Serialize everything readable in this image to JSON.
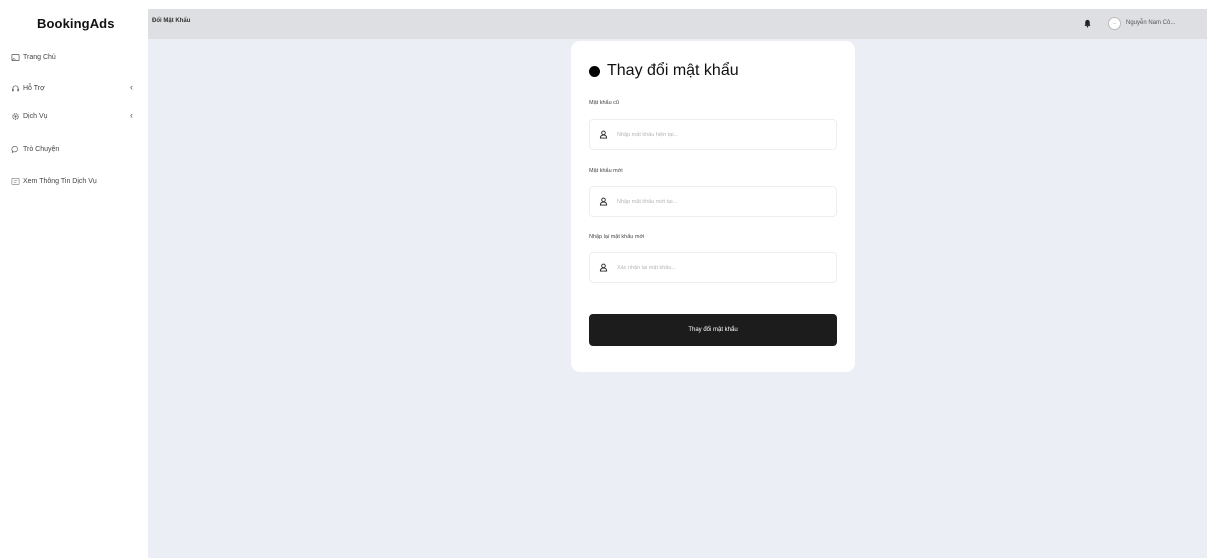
{
  "app": {
    "logo": "BookingAds"
  },
  "sidebar": {
    "items": [
      {
        "label": "Trang Chủ",
        "icon": "home-icon"
      },
      {
        "label": "Hỗ Trợ",
        "icon": "headset-icon",
        "has_submenu": true
      },
      {
        "label": "Dịch Vụ",
        "icon": "gear-icon",
        "has_submenu": true
      },
      {
        "label": "Trò Chuyện",
        "icon": "chat-icon"
      },
      {
        "label": "Xem Thông Tin Dịch Vụ",
        "icon": "info-icon"
      }
    ],
    "chevron": "‹",
    "collapse_handle": "›"
  },
  "header": {
    "title": "Đổi Mật Khẩu",
    "avatar_text": "...",
    "username": "Nguyễn Nam Cô..."
  },
  "form": {
    "title": "Thay đổi mật khẩu",
    "old_password": {
      "label": "Mật khẩu cũ",
      "placeholder": "Nhập mật khẩu hiện tại..."
    },
    "new_password": {
      "label": "Mật khẩu mới",
      "placeholder": "Nhập mật khẩu mới tại..."
    },
    "confirm_password": {
      "label": "Nhập lại mật khẩu mới",
      "placeholder": "Xác nhận lại mật khẩu..."
    },
    "submit_label": "Thay đổi mật khẩu"
  },
  "colors": {
    "content_bg": "#eceef5",
    "header_bg": "#dedfe2",
    "button_bg": "#1c1c1c"
  }
}
